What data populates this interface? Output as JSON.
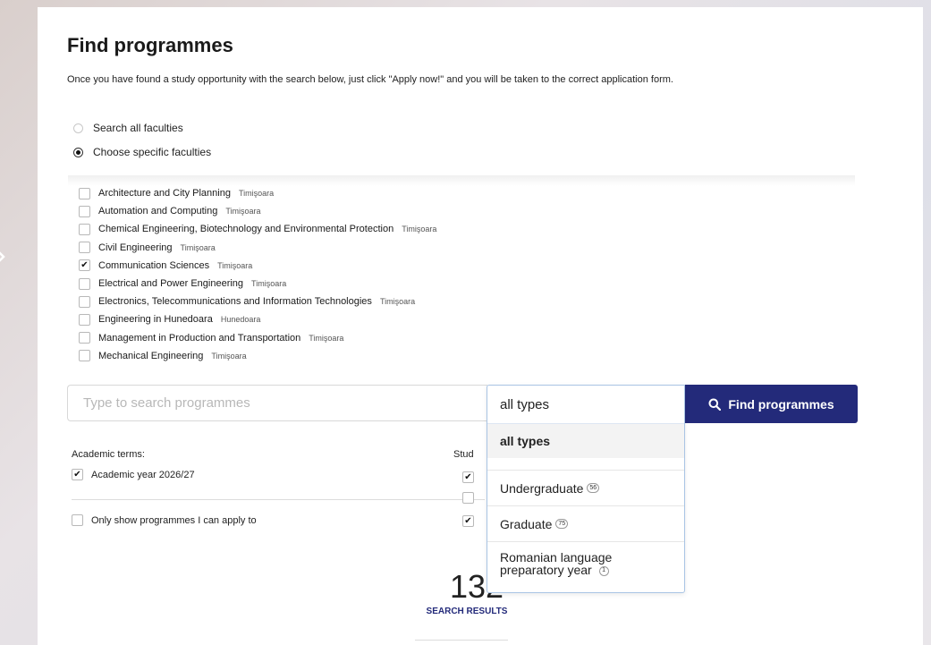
{
  "page": {
    "title": "Find programmes",
    "intro": "Once you have found a study opportunity with the search below, just click \"Apply now!\" and you will be taken to the correct application form."
  },
  "scope": {
    "options": [
      {
        "label": "Search all faculties",
        "checked": false
      },
      {
        "label": "Choose specific faculties",
        "checked": true
      }
    ]
  },
  "faculties": [
    {
      "name": "Architecture and City Planning",
      "city": "Timişoara",
      "checked": false
    },
    {
      "name": "Automation and Computing",
      "city": "Timişoara",
      "checked": false
    },
    {
      "name": "Chemical Engineering, Biotechnology and Environmental Protection",
      "city": "Timişoara",
      "checked": false
    },
    {
      "name": "Civil Engineering",
      "city": "Timişoara",
      "checked": false
    },
    {
      "name": "Communication Sciences",
      "city": "Timişoara",
      "checked": true
    },
    {
      "name": "Electrical and Power Engineering",
      "city": "Timişoara",
      "checked": false
    },
    {
      "name": "Electronics, Telecommunications and Information Technologies",
      "city": "Timişoara",
      "checked": false
    },
    {
      "name": "Engineering in Hunedoara",
      "city": "Hunedoara",
      "checked": false
    },
    {
      "name": "Management in Production and Transportation",
      "city": "Timişoara",
      "checked": false
    },
    {
      "name": "Mechanical Engineering",
      "city": "Timişoara",
      "checked": false
    }
  ],
  "search": {
    "placeholder": "Type to search programmes",
    "button_label": "Find programmes",
    "button_color": "#232a7a"
  },
  "type_select": {
    "current": "all types",
    "selected_option": "all types",
    "options": [
      {
        "label": "Undergraduate",
        "count": "56"
      },
      {
        "label": "Graduate",
        "count": "75"
      },
      {
        "label_line1": "Romanian language",
        "label_line2": "preparatory year",
        "count": "1"
      }
    ]
  },
  "filters": {
    "terms_label": "Academic terms:",
    "term": {
      "label": "Academic year 2026/27",
      "checked": true
    },
    "only_apply": {
      "label": "Only show programmes I can apply to",
      "checked": false
    },
    "study_label_partial": "Stud"
  },
  "results": {
    "count": "132",
    "label": "SEARCH RESULTS"
  },
  "icons": {
    "search_button": "search-icon",
    "left_edge": "chevron-right-icon"
  }
}
